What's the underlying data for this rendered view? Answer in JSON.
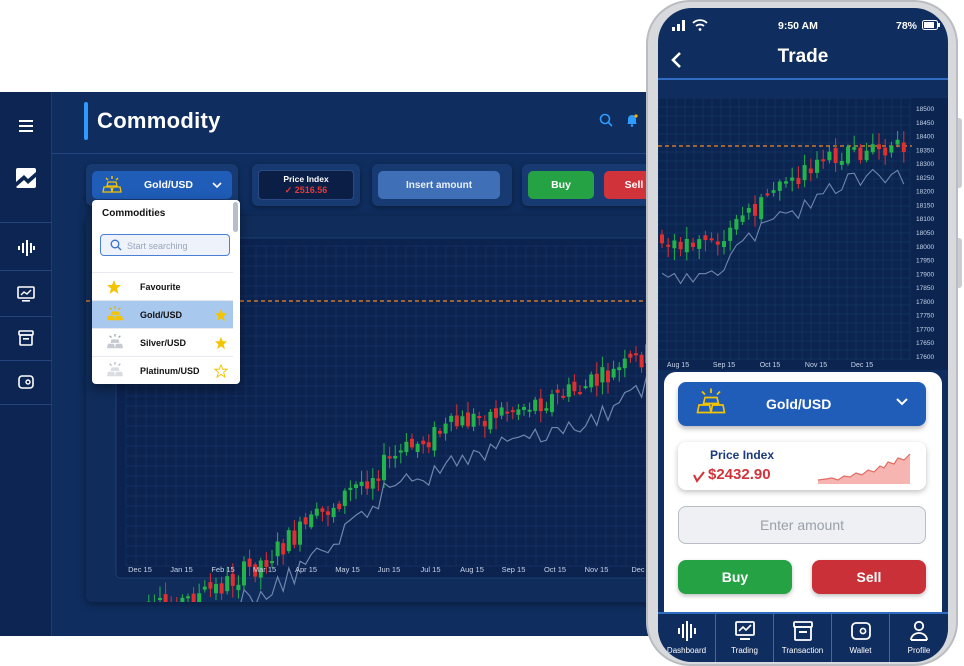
{
  "desktop": {
    "page_title": "Commodity",
    "sidebar": [
      "menu-icon",
      "logo-icon",
      "dashboard-icon",
      "trading-icon",
      "transaction-icon",
      "wallet-icon"
    ],
    "header_icons": [
      "search-icon",
      "bell-icon"
    ],
    "selector": {
      "label": "Gold/USD"
    },
    "price_index": {
      "label": "Price Index",
      "value": "2516.56"
    },
    "amount_button": "Insert amount",
    "buy_label": "Buy",
    "sell_label": "Sell",
    "dropdown": {
      "title": "Commodities",
      "search_placeholder": "Start searching",
      "items": [
        {
          "label": "Favourite",
          "starred": true
        },
        {
          "label": "Gold/USD",
          "starred": true,
          "selected": true
        },
        {
          "label": "Silver/USD",
          "starred": true
        },
        {
          "label": "Platinum/USD",
          "starred": false
        }
      ]
    }
  },
  "chart_data": [
    {
      "type": "candlestick",
      "x_tick_labels": [
        "Dec 15",
        "Jan 15",
        "Feb 15",
        "Mar 15",
        "Apr 15",
        "May 15",
        "Jun 15",
        "Jul 15",
        "Aug 15",
        "Sep 15",
        "Oct 15",
        "Nov 15",
        "Dec"
      ],
      "reference_line": "dashed orange",
      "colors": {
        "up": "#24b24b",
        "down": "#e02f2f",
        "reference": "#f08a2a"
      }
    },
    {
      "type": "candlestick",
      "x_tick_labels": [
        "Aug 15",
        "Sep 15",
        "Oct 15",
        "Nov 15",
        "Dec 15"
      ],
      "y_tick_labels": [
        "18500",
        "18450",
        "18400",
        "18350",
        "18300",
        "18250",
        "18200",
        "18150",
        "18100",
        "18050",
        "18000",
        "17950",
        "17900",
        "17850",
        "17800",
        "17750",
        "17700",
        "17650",
        "17600"
      ],
      "ylim": [
        17600,
        18500
      ],
      "colors": {
        "up": "#24b24b",
        "down": "#e02f2f",
        "reference": "#f08a2a"
      }
    }
  ],
  "mobile": {
    "status": {
      "time": "9:50 AM",
      "battery": "78%"
    },
    "title": "Trade",
    "selector": {
      "label": "Gold/USD"
    },
    "price_index": {
      "label": "Price Index",
      "value": "$2432.90"
    },
    "amount_placeholder": "Enter amount",
    "buy_label": "Buy",
    "sell_label": "Sell",
    "nav": [
      "Dashboard",
      "Trading",
      "Transaction",
      "Wallet",
      "Profile"
    ]
  },
  "colors": {
    "accent": "#1f5db8",
    "background": "#0f2d5e",
    "buy": "#25a244",
    "sell": "#d1333b"
  }
}
